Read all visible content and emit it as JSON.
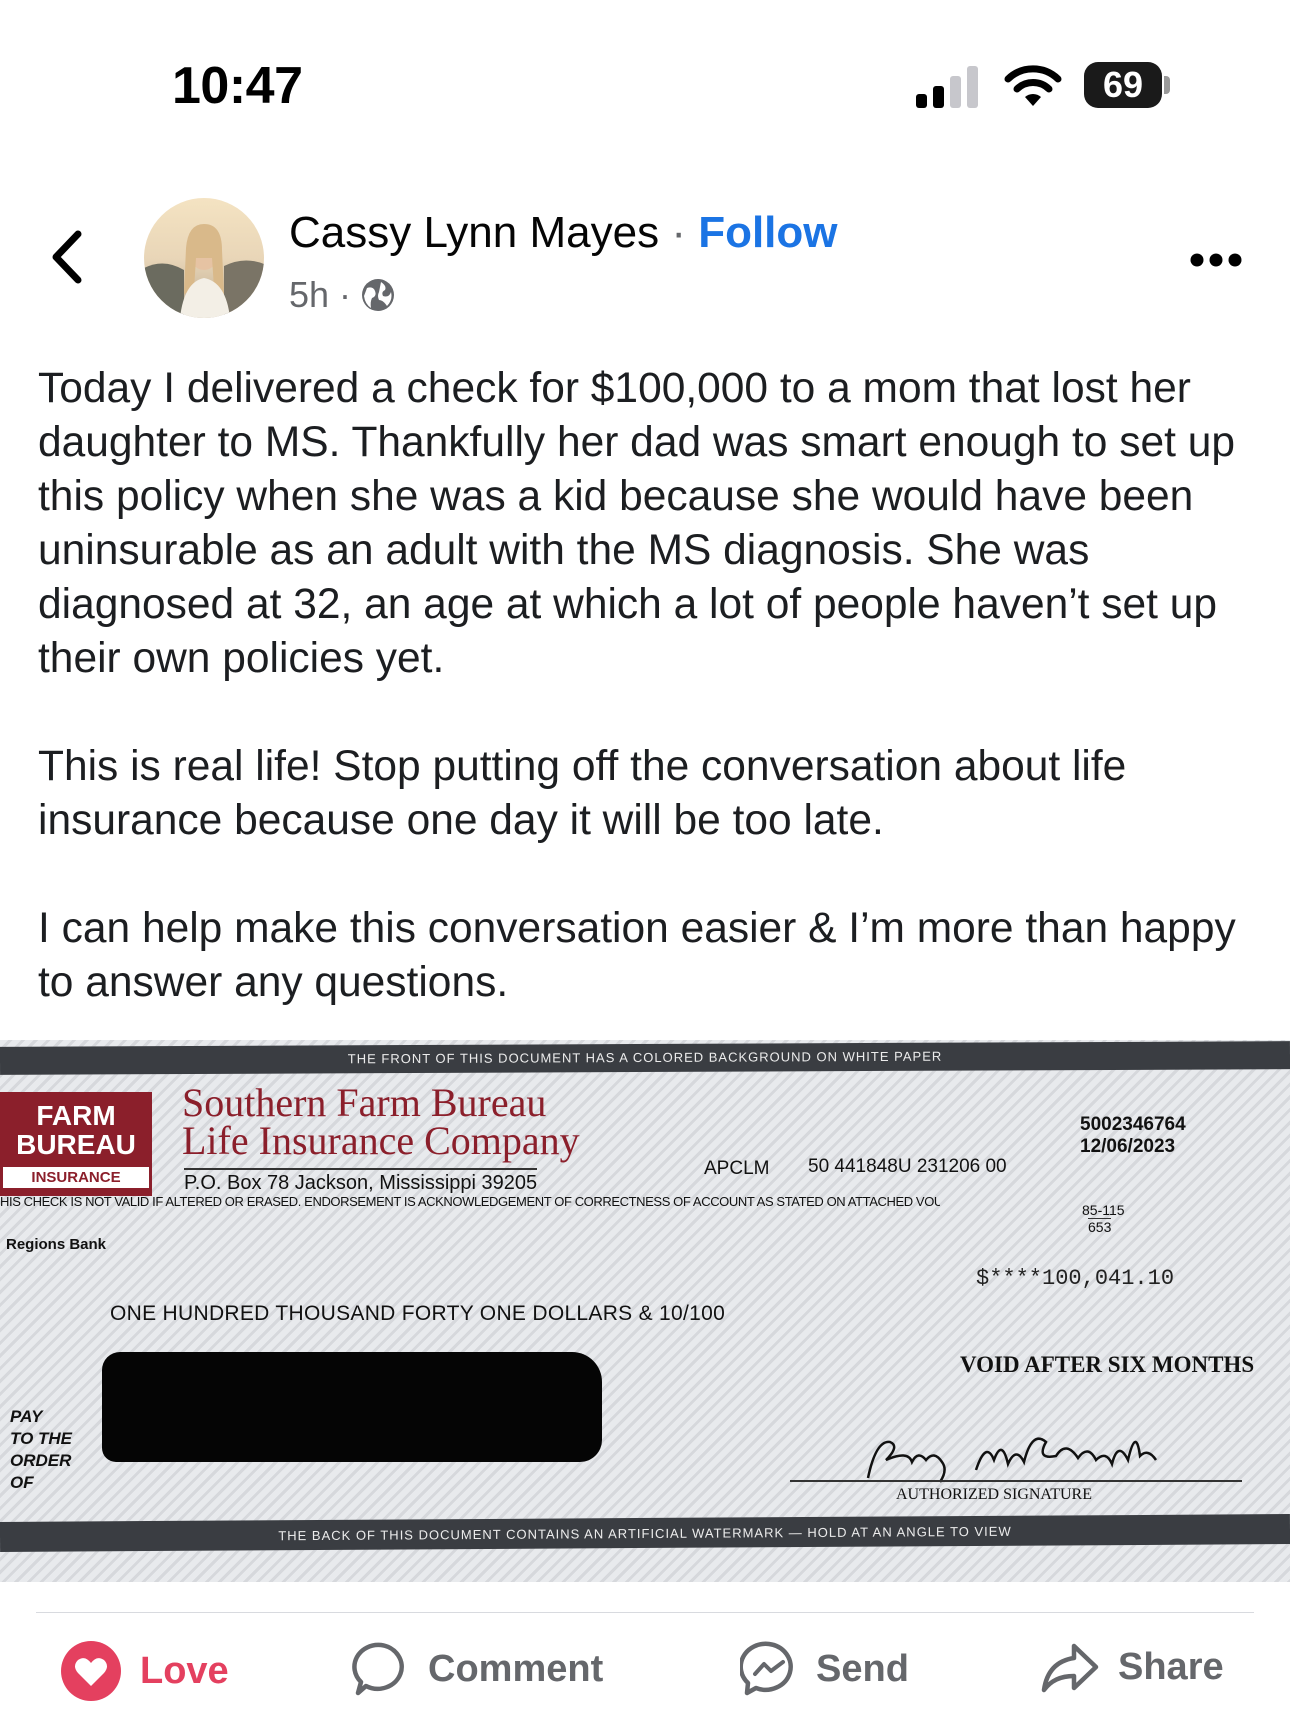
{
  "status_bar": {
    "time": "10:47",
    "battery": "69"
  },
  "post": {
    "author": "Cassy Lynn Mayes",
    "separator": "·",
    "follow_label": "Follow",
    "age": "5h",
    "meta_separator": "·",
    "paragraphs": [
      "Today I delivered a check for $100,000 to a mom that lost her daughter to MS. Thankfully her dad was smart enough to set up this policy when she was a kid because she would have been uninsurable as an adult with the MS diagnosis. She was diagnosed at 32, an age at which a lot of people haven’t set up their own policies yet.",
      "This is real life! Stop putting off the conversation about life insurance because one day it will be too late.",
      "I can help make this conversation easier & I’m more than happy to answer any questions."
    ]
  },
  "check": {
    "top_band": "THE FRONT OF THIS DOCUMENT HAS A COLORED BACKGROUND ON WHITE PAPER",
    "logo_line1": "FARM",
    "logo_line2": "BUREAU",
    "logo_line3": "INSURANCE",
    "company_line1": "Southern Farm Bureau",
    "company_line2": "Life Insurance Company",
    "address": "P.O. Box 78 Jackson, Mississippi 39205",
    "code": "APCLM",
    "reference": "50 441848U 231206 00",
    "check_number": "5002346764",
    "date": "12/06/2023",
    "notice": "HIS CHECK IS NOT VALID IF ALTERED OR ERASED. ENDORSEMENT IS ACKNOWLEDGEMENT OF CORRECTNESS OF ACCOUNT AS STATED ON ATTACHED VOUCHER.",
    "routing_top": "85-115",
    "routing_bottom": "653",
    "bank": "Regions Bank",
    "amount": "$****100,041.10",
    "amount_words": "ONE HUNDRED THOUSAND FORTY ONE DOLLARS & 10/100",
    "void_notice": "VOID AFTER SIX MONTHS",
    "pay_line1": "PAY",
    "pay_line2": "TO THE",
    "pay_line3": "ORDER",
    "pay_line4": "OF",
    "signature_label": "AUTHORIZED SIGNATURE",
    "bottom_band": "THE BACK OF THIS DOCUMENT CONTAINS AN ARTIFICIAL WATERMARK — HOLD AT AN ANGLE TO VIEW"
  },
  "actions": [
    {
      "label": "Love",
      "icon": "heart-icon",
      "color": "#e4405f"
    },
    {
      "label": "Comment",
      "icon": "comment-icon"
    },
    {
      "label": "Send",
      "icon": "messenger-icon"
    },
    {
      "label": "Share",
      "icon": "share-icon"
    }
  ],
  "colors": {
    "accent": "#1b74e4",
    "love": "#e4405f",
    "check_brand": "#8b1f2b"
  }
}
